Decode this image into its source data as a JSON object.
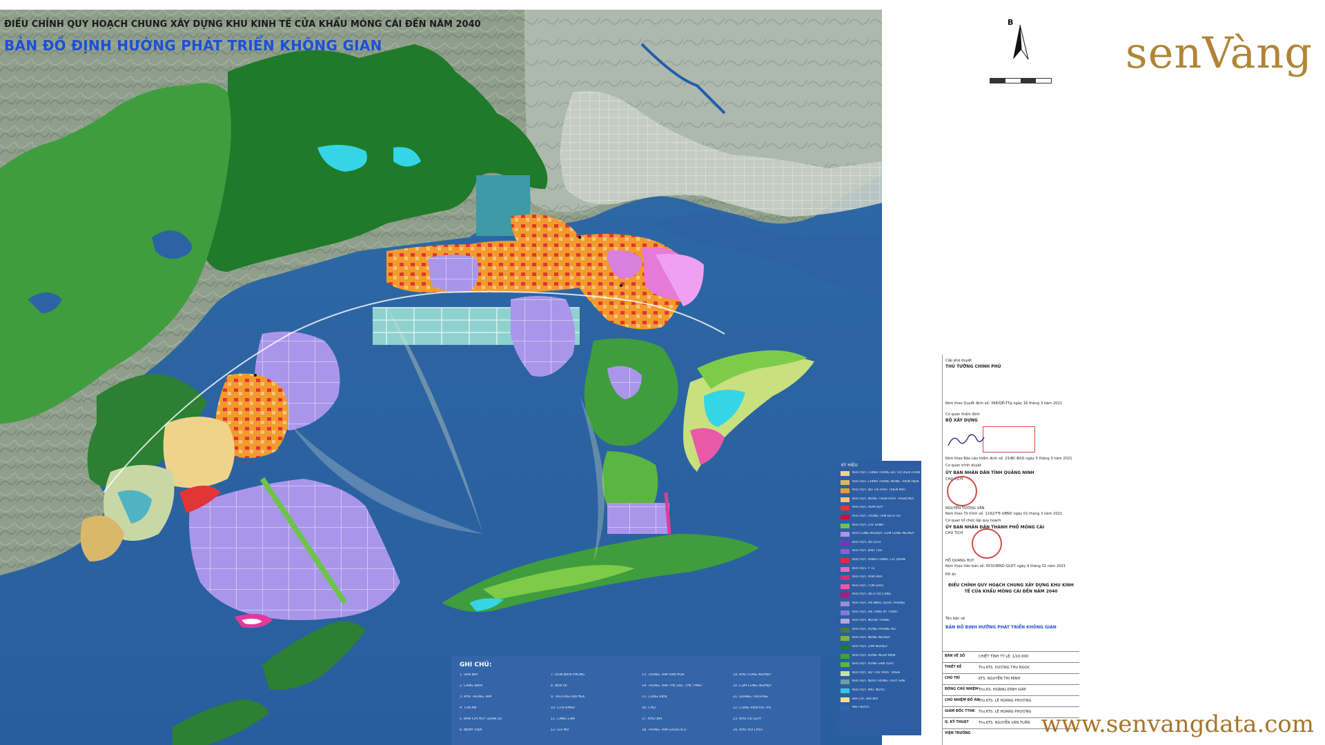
{
  "title_line1": "ĐIỀU CHỈNH QUY HOẠCH CHUNG XÂY DỰNG KHU KINH TẾ CỬA KHẨU MÓNG CÁI ĐẾN NĂM 2040",
  "title_line2": "BẢN ĐỒ ĐỊNH HƯỚNG PHÁT TRIỂN KHÔNG GIAN",
  "north_letter": "B",
  "brand_logo": "senVàng",
  "brand_url": "www.senvangdata.com",
  "colors": {
    "sea": "#2c63a4",
    "land_relief": "#8e9e88",
    "forest": "#1f7a2a",
    "industrial": "#a996ea",
    "residential": "#f08e1a",
    "commercial": "#e23a9a",
    "green_space": "#7ecb4a",
    "water_surface": "#34d6e6"
  },
  "legend": {
    "title": "KÝ HIỆU",
    "items": [
      {
        "label": "KHU VỰC CHỈNH TRANG ĐÔ THỊ HIỆN TRẠNG",
        "color": "#f0d38a"
      },
      {
        "label": "KHU VỰC CHỈNH TRANG NÔNG THÔN HIỆN TRẠNG",
        "color": "#d9b86a"
      },
      {
        "label": "KHU VỰC ĐÔ THỊ PHÁT TRIỂN MỚI",
        "color": "#f39a2c"
      },
      {
        "label": "KHU VỰC NÔNG THÔN PHÁT TRIỂN MỚI",
        "color": "#f5c47d"
      },
      {
        "label": "KHU VỰC HỖN HỢP",
        "color": "#e23535"
      },
      {
        "label": "KHU VỰC TRUNG TÂM DỊCH VỤ",
        "color": "#c0163d"
      },
      {
        "label": "KHU VỰC CÂY XANH",
        "color": "#6fc24b"
      },
      {
        "label": "KHU CÔNG NGHIỆP, CỤM CÔNG NGHIỆP",
        "color": "#a896ea"
      },
      {
        "label": "KHU VỰC DU LỊCH",
        "color": "#7a33b8"
      },
      {
        "label": "KHU VỰC ĐÀO TẠO",
        "color": "#8a63c9"
      },
      {
        "label": "KHU VỰC HÀNH CHÍNH, CƠ QUAN",
        "color": "#e52c2c"
      },
      {
        "label": "KHU VỰC Y TẾ",
        "color": "#e06bc0"
      },
      {
        "label": "KHU VỰC VĂN HÓA",
        "color": "#d02f7d"
      },
      {
        "label": "KHU VỰC TÔN GIÁO",
        "color": "#e85aa6"
      },
      {
        "label": "KHU VỰC DỊCH VỤ CẢNG",
        "color": "#b01878"
      },
      {
        "label": "KHU VỰC AN NINH, QUỐC PHÒNG",
        "color": "#9d8bd8"
      },
      {
        "label": "KHU VỰC HẠ TẦNG KỸ THUẬT",
        "color": "#7d7dd6"
      },
      {
        "label": "KHU VỰC NGHĨA TRANG",
        "color": "#b7a7e0"
      },
      {
        "label": "KHU VỰC RỪNG PHÒNG HỘ",
        "color": "#4d7b3d"
      },
      {
        "label": "KHU VỰC NÔNG NGHIỆP",
        "color": "#7fb04a"
      },
      {
        "label": "KHU VỰC LÂM NGHIỆP",
        "color": "#1c7a2b"
      },
      {
        "label": "KHU VỰC RỪNG NGẬP MẶN",
        "color": "#38a53e"
      },
      {
        "label": "KHU VỰC RỪNG SẢN XUẤT",
        "color": "#5ab543"
      },
      {
        "label": "KHU VỰC DỰ TRỮ PHÁT TRIỂN",
        "color": "#c7e39a"
      },
      {
        "label": "KHU VỰC NUÔI TRỒNG THỦY SẢN",
        "color": "#6f9da3"
      },
      {
        "label": "KHU VỰC MẶT NƯỚC",
        "color": "#34c8e0"
      },
      {
        "label": "BÃI CÁT, BÃI BỒI",
        "color": "#f3e08a"
      },
      {
        "label": "MẶT NƯỚC",
        "color": "#2f67b2"
      }
    ]
  },
  "notes": {
    "title": "GHI CHÚ:",
    "items": [
      "1. SÂN BAY",
      "2. CẢNG BIỂN",
      "3. KHU TRUNG TÂM",
      "4. TÒA ÁN",
      "5. BAN CHỈ HUY QUÂN SỰ",
      "6. BỆNH VIỆN",
      "7. ĐỒN BIÊN PHÒNG",
      "8. BẾN XE",
      "9. TRƯỜNG ĐẠI HỌC",
      "10. CỬA KHẨU",
      "11. CẢNG CẠN",
      "12. LỐI MỞ",
      "13. TRUNG TÂM VĂN HÓA",
      "14. TRUNG TÂM THỂ DỤC THỂ THAO",
      "15. CÔNG VIÊN",
      "16. CHỢ",
      "17. KHO BÃI",
      "18. TRUNG TÂM LOGISTICS",
      "19. KHU CÔNG NGHIỆP",
      "20. CỤM CÔNG NGHIỆP",
      "21. QUẢNG TRƯỜNG",
      "22. CÔNG VIÊN ĐÔ THỊ",
      "23. KHU DU LỊCH",
      "24. KHU VUI CHƠI"
    ]
  },
  "title_block": {
    "approve_level": "Cấp phê duyệt",
    "approver": "THỦ TƯỚNG CHÍNH PHỦ",
    "decision": "Kèm theo Quyết định số: 368/QĐ-TTg ngày 16 tháng 3 năm 2021",
    "appraiser_label": "Cơ quan thẩm định",
    "appraiser": "BỘ XÂY DỰNG",
    "appraisal_report": "Kèm theo Báo cáo thẩm định số: 23/BC-BXD ngày 5 tháng 3 năm 2021",
    "submitter_label": "Cơ quan trình duyệt",
    "submitter": "ỦY BAN NHÂN DÂN TỈNH QUẢNG NINH",
    "submitter_role": "CHỦ TỊCH",
    "submitter_name": "NGUYỄN TƯỜNG VĂN",
    "submitter_doc": "Kèm theo Tờ trình số: 1192/TTr-UBND ngày 01 tháng 3 năm 2021",
    "organizer_label": "Cơ quan tổ chức lập quy hoạch",
    "organizer": "ỦY BAN NHÂN DÂN THÀNH PHỐ MÓNG CÁI",
    "organizer_role": "CHỦ TỊCH",
    "organizer_name": "HỒ QUANG HUY",
    "organizer_doc": "Kèm theo Văn bản số: 653/UBND-QLĐT ngày 9 tháng 02 năm 2021",
    "project_label": "Đồ án",
    "project_name": "ĐIỀU CHỈNH QUY HOẠCH CHUNG XÂY DỰNG KHU KINH TẾ CỬA KHẨU MÓNG CÁI ĐẾN NĂM 2040",
    "sheet_label": "Tên bản vẽ",
    "sheet_name": "BẢN ĐỒ ĐỊNH HƯỚNG PHÁT TRIỂN KHÔNG GIAN",
    "rows": [
      {
        "k": "BẢN VẼ SỐ",
        "v": "CHIẾT TÍNH    TỶ LỆ: 1/10.000"
      },
      {
        "k": "THIẾT KẾ",
        "v": "Ths.KTS. DƯƠNG THU NGỌC"
      },
      {
        "k": "CHỦ TRÌ",
        "v": "KTS. NGUYỄN THỊ MINH"
      },
      {
        "k": "ĐÔNG CHỦ NHIỆM",
        "v": "Ths.KS. HOÀNG ĐÌNH GIÁP"
      },
      {
        "k": "CHỦ NHIỆM ĐỒ ÁN",
        "v": "Ths.KTS. LÊ HOÀNG PHƯƠNG"
      },
      {
        "k": "GIÁM ĐỐC TTHK",
        "v": "Ths.KTS. LÊ HOÀNG PHƯƠNG"
      },
      {
        "k": "Q. KỸ THUẬT",
        "v": "Ths.KTS. NGUYỄN VĂN TUẤN"
      },
      {
        "k": "VIỆN TRƯỞNG",
        "v": ""
      }
    ]
  }
}
